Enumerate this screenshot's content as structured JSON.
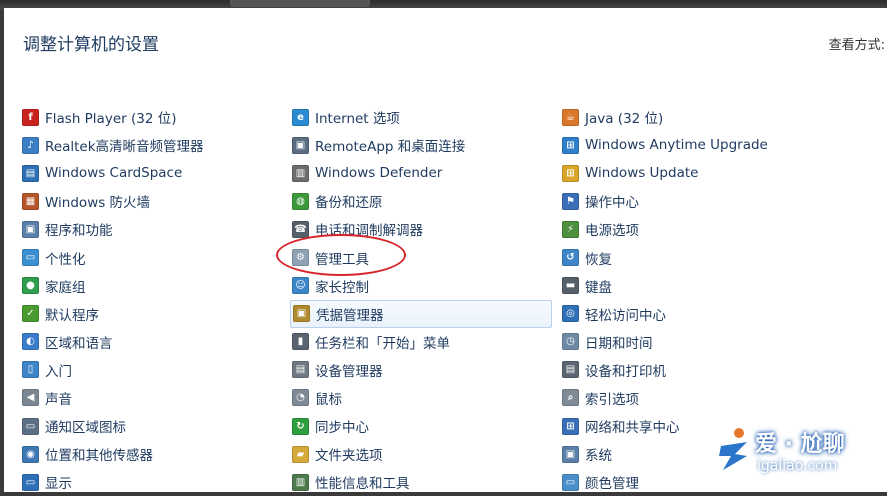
{
  "title": "调整计算机的设置",
  "view_by_label": "查看方式:",
  "columns": [
    [
      {
        "label": "Flash Player (32 位)",
        "icon": "flash-icon",
        "color": "#c8231e",
        "glyph": "f"
      },
      {
        "label": "Realtek高清晰音频管理器",
        "icon": "realtek-audio-icon",
        "color": "#3d7fc4",
        "glyph": "♪"
      },
      {
        "label": "Windows CardSpace",
        "icon": "cardspace-icon",
        "color": "#2e6fb5",
        "glyph": "▤"
      },
      {
        "label": "Windows 防火墙",
        "icon": "firewall-icon",
        "color": "#b5562a",
        "glyph": "▦"
      },
      {
        "label": "程序和功能",
        "icon": "programs-icon",
        "color": "#5a7fa8",
        "glyph": "▣"
      },
      {
        "label": "个性化",
        "icon": "personalization-icon",
        "color": "#3a8fd1",
        "glyph": "▭"
      },
      {
        "label": "家庭组",
        "icon": "homegroup-icon",
        "color": "#2f9e4f",
        "glyph": "●"
      },
      {
        "label": "默认程序",
        "icon": "default-programs-icon",
        "color": "#4a9b2f",
        "glyph": "✓"
      },
      {
        "label": "区域和语言",
        "icon": "region-icon",
        "color": "#3a7cc9",
        "glyph": "◐"
      },
      {
        "label": "入门",
        "icon": "getting-started-icon",
        "color": "#3f86c8",
        "glyph": "▯"
      },
      {
        "label": "声音",
        "icon": "sound-icon",
        "color": "#7b8793",
        "glyph": "◀"
      },
      {
        "label": "通知区域图标",
        "icon": "notification-area-icon",
        "color": "#5c6f85",
        "glyph": "▭"
      },
      {
        "label": "位置和其他传感器",
        "icon": "sensors-icon",
        "color": "#3e78b5",
        "glyph": "◉"
      },
      {
        "label": "显示",
        "icon": "display-icon",
        "color": "#2f6fb8",
        "glyph": "▭"
      }
    ],
    [
      {
        "label": "Internet 选项",
        "icon": "internet-options-icon",
        "color": "#2a8bd0",
        "glyph": "e"
      },
      {
        "label": "RemoteApp 和桌面连接",
        "icon": "remoteapp-icon",
        "color": "#5a6d82",
        "glyph": "▣"
      },
      {
        "label": "Windows Defender",
        "icon": "defender-icon",
        "color": "#6d6d6d",
        "glyph": "▥"
      },
      {
        "label": "备份和还原",
        "icon": "backup-icon",
        "color": "#3c9a3a",
        "glyph": "◍"
      },
      {
        "label": "电话和调制解调器",
        "icon": "phone-modem-icon",
        "color": "#56606b",
        "glyph": "☎"
      },
      {
        "label": "管理工具",
        "icon": "admin-tools-icon",
        "color": "#8ea1b5",
        "glyph": "⚙"
      },
      {
        "label": "家长控制",
        "icon": "parental-controls-icon",
        "color": "#3a86c8",
        "glyph": "☺"
      },
      {
        "label": "凭据管理器",
        "icon": "credential-manager-icon",
        "color": "#b08a2e",
        "glyph": "▣",
        "highlight": true
      },
      {
        "label": "任务栏和「开始」菜单",
        "icon": "taskbar-icon",
        "color": "#5a6470",
        "glyph": "▮"
      },
      {
        "label": "设备管理器",
        "icon": "device-manager-icon",
        "color": "#6f7a85",
        "glyph": "▤"
      },
      {
        "label": "鼠标",
        "icon": "mouse-icon",
        "color": "#7e8a96",
        "glyph": "◔"
      },
      {
        "label": "同步中心",
        "icon": "sync-center-icon",
        "color": "#2e9e3e",
        "glyph": "↻"
      },
      {
        "label": "文件夹选项",
        "icon": "folder-options-icon",
        "color": "#d6a93a",
        "glyph": "▰"
      },
      {
        "label": "性能信息和工具",
        "icon": "performance-icon",
        "color": "#4d7a4d",
        "glyph": "▥"
      }
    ],
    [
      {
        "label": "Java (32 位)",
        "icon": "java-icon",
        "color": "#d9772b",
        "glyph": "☕"
      },
      {
        "label": "Windows Anytime Upgrade",
        "icon": "anytime-upgrade-icon",
        "color": "#2f7fc8",
        "glyph": "⊞"
      },
      {
        "label": "Windows Update",
        "icon": "windows-update-icon",
        "color": "#d9a62a",
        "glyph": "⊞"
      },
      {
        "label": "操作中心",
        "icon": "action-center-icon",
        "color": "#3a6fb8",
        "glyph": "⚑"
      },
      {
        "label": "电源选项",
        "icon": "power-options-icon",
        "color": "#4c8f3c",
        "glyph": "⚡"
      },
      {
        "label": "恢复",
        "icon": "recovery-icon",
        "color": "#3f86c8",
        "glyph": "↺"
      },
      {
        "label": "键盘",
        "icon": "keyboard-icon",
        "color": "#56606b",
        "glyph": "▬"
      },
      {
        "label": "轻松访问中心",
        "icon": "ease-of-access-icon",
        "color": "#2f6fb8",
        "glyph": "◎"
      },
      {
        "label": "日期和时间",
        "icon": "date-time-icon",
        "color": "#6f8aa6",
        "glyph": "◷"
      },
      {
        "label": "设备和打印机",
        "icon": "devices-printers-icon",
        "color": "#5b6672",
        "glyph": "▤"
      },
      {
        "label": "索引选项",
        "icon": "indexing-icon",
        "color": "#7e8a96",
        "glyph": "⌕"
      },
      {
        "label": "网络和共享中心",
        "icon": "network-sharing-icon",
        "color": "#3a6fb8",
        "glyph": "⊞"
      },
      {
        "label": "系统",
        "icon": "system-icon",
        "color": "#5a7fa8",
        "glyph": "▣"
      },
      {
        "label": "颜色管理",
        "icon": "color-management-icon",
        "color": "#4a8fc9",
        "glyph": "▭"
      }
    ]
  ],
  "watermark": {
    "text": "爱 · 尬聊",
    "url": "igaliao.com"
  },
  "colors": {
    "link": "#1e3a5f",
    "annotation": "#d7262b",
    "title": "#1e3a5f"
  }
}
